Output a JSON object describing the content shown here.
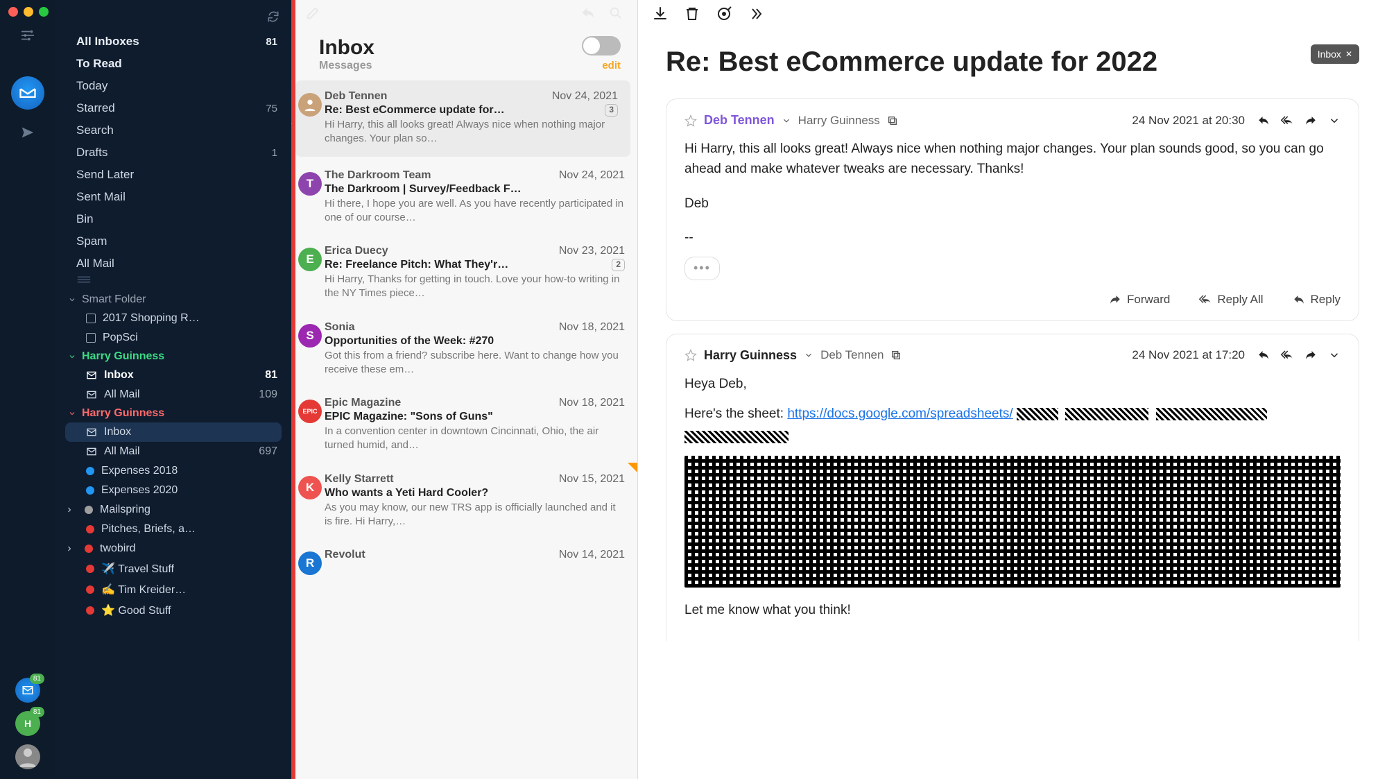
{
  "rail": {
    "badge1": "81",
    "badge2": "81",
    "avatar_letter": "H"
  },
  "sidebar": {
    "top": [
      {
        "label": "All Inboxes",
        "count": "81",
        "bold": true
      },
      {
        "label": "To Read",
        "count": "",
        "bold": true
      },
      {
        "label": "Today",
        "count": "",
        "bold": false
      },
      {
        "label": "Starred",
        "count": "75",
        "bold": false
      },
      {
        "label": "Search",
        "count": "",
        "bold": false
      },
      {
        "label": "Drafts",
        "count": "1",
        "bold": false
      },
      {
        "label": "Send Later",
        "count": "",
        "bold": false
      },
      {
        "label": "Sent Mail",
        "count": "",
        "bold": false
      },
      {
        "label": "Bin",
        "count": "",
        "bold": false
      },
      {
        "label": "Spam",
        "count": "",
        "bold": false
      },
      {
        "label": "All Mail",
        "count": "",
        "bold": false
      }
    ],
    "smart": {
      "header": "Smart Folder",
      "items": [
        {
          "label": "2017 Shopping R…"
        },
        {
          "label": "PopSci"
        }
      ]
    },
    "acct1": {
      "header": "Harry Guinness",
      "rows": [
        {
          "label": "Inbox",
          "count": "81",
          "bold": true
        },
        {
          "label": "All Mail",
          "count": "109",
          "bold": false
        }
      ]
    },
    "acct2": {
      "header": "Harry Guinness",
      "rows": [
        {
          "label": "Inbox",
          "count": "",
          "sel": true
        },
        {
          "label": "All Mail",
          "count": "697"
        },
        {
          "label": "Expenses 2018",
          "dot": "#2196f3"
        },
        {
          "label": "Expenses 2020",
          "dot": "#2196f3"
        },
        {
          "label": "Mailspring",
          "dot": "#9e9e9e",
          "chev": true
        },
        {
          "label": "Pitches, Briefs, a…",
          "dot": "#e53935"
        },
        {
          "label": "twobird",
          "dot": "#e53935",
          "chev": true
        },
        {
          "label": "✈️ Travel Stuff",
          "dot": "#e53935"
        },
        {
          "label": "✍️ Tim Kreider…",
          "dot": "#e53935"
        },
        {
          "label": "⭐ Good Stuff",
          "dot": "#e53935"
        }
      ]
    }
  },
  "msglist": {
    "title": "Inbox",
    "subtitle": "Messages",
    "edit": "edit",
    "messages": [
      {
        "from": "Deb Tennen",
        "date": "Nov 24, 2021",
        "subj": "Re: Best eCommerce update for…",
        "badge": "3",
        "prev": "Hi Harry, this all looks great! Always nice when nothing major changes. Your plan so…",
        "avBg": "#c9a27a",
        "avTxt": "",
        "sel": true
      },
      {
        "from": "The Darkroom Team",
        "date": "Nov 24, 2021",
        "subj": "The Darkroom | Survey/Feedback F…",
        "prev": "Hi there, I hope you are well. As you have recently participated in one of our course…",
        "avBg": "#8e44ad",
        "avTxt": "T"
      },
      {
        "from": "Erica Duecy",
        "date": "Nov 23, 2021",
        "subj": "Re: Freelance Pitch: What They'r…",
        "badge": "2",
        "prev": "Hi Harry, Thanks for getting in touch. Love your how-to writing in the NY Times piece…",
        "avBg": "#4caf50",
        "avTxt": "E"
      },
      {
        "from": "Sonia",
        "date": "Nov 18, 2021",
        "subj": "Opportunities of the Week: #270",
        "prev": "Got this from a friend? subscribe here. Want to change how you receive these em…",
        "avBg": "#9c27b0",
        "avTxt": "S"
      },
      {
        "from": "Epic Magazine",
        "date": "Nov 18, 2021",
        "subj": "EPIC Magazine: \"Sons of Guns\"",
        "prev": "In a convention center in downtown Cincinnati, Ohio, the air turned humid, and…",
        "avBg": "#e53935",
        "avTxt": "EPIC",
        "flag": true
      },
      {
        "from": "Kelly Starrett",
        "date": "Nov 15, 2021",
        "subj": "Who wants a Yeti Hard Cooler?",
        "prev": "As you may know, our new TRS app is officially launched and it is fire. Hi Harry,…",
        "avBg": "#ef5350",
        "avTxt": "K"
      },
      {
        "from": "Revolut",
        "date": "Nov 14, 2021",
        "subj": "",
        "prev": "",
        "avBg": "#1976d2",
        "avTxt": "R"
      }
    ]
  },
  "reader": {
    "title": "Re: Best eCommerce update for 2022",
    "chip": "Inbox",
    "card1": {
      "from_main": "Deb Tennen",
      "to": "Harry Guinness",
      "date": "24 Nov 2021 at 20:30",
      "body1": "Hi Harry, this all looks great! Always nice when nothing major changes. Your plan sounds good, so you can go ahead and make whatever tweaks are necessary. Thanks!",
      "body2": "Deb",
      "sig": "--",
      "more": "•••",
      "forward": "Forward",
      "replyall": "Reply All",
      "reply": "Reply"
    },
    "card2": {
      "from_main": "Harry Guinness",
      "to": "Deb Tennen",
      "date": "24 Nov 2021 at 17:20",
      "line1": "Heya Deb,",
      "line2a": "Here's the sheet: ",
      "link": "https://docs.google.com/spreadsheets/",
      "tail": "Let me know what you think!"
    }
  }
}
